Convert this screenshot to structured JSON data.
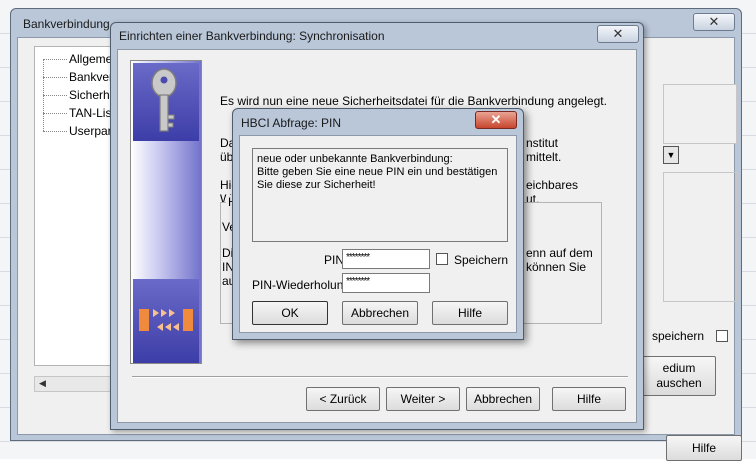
{
  "bank_window": {
    "title": "Bankverbindung",
    "close_glyph": "✕",
    "tree_items": [
      "Allgemein",
      "Bankverbin",
      "Sicherheits",
      "TAN-Listen",
      "Userparam"
    ],
    "save_label": "speichern",
    "medium_button_label": "edium\nauschen",
    "help_button": "Hilfe"
  },
  "setup_window": {
    "title": "Einrichten einer Bankverbindung: Synchronisation",
    "close_glyph": "✕",
    "intro_text": "Es wird nun eine neue Sicherheitsdatei für die Bankverbindung angelegt.",
    "para1_left": [
      "Da",
      "übe"
    ],
    "para1_right": [
      "nstitut",
      "mittelt."
    ],
    "para2_left": [
      "Hie",
      "We"
    ],
    "para2_right": [
      "eichbares",
      "ut."
    ],
    "group_left": [
      "H",
      "Ve",
      "Di",
      "IN",
      "au"
    ],
    "group_right": [
      "enn auf dem",
      "können Sie"
    ],
    "buttons": {
      "back": "< Zurück",
      "next": "Weiter >",
      "cancel": "Abbrechen",
      "help": "Hilfe"
    }
  },
  "pin_dialog": {
    "title": "HBCI Abfrage: PIN",
    "close_glyph": "✕",
    "message": "neue oder unbekannte Bankverbindung:\n Bitte geben Sie eine neue PIN ein und bestätigen\nSie diese zur Sicherheit!",
    "pin_label": "PIN",
    "pin_value": "********",
    "save_label": "Speichern",
    "pin_repeat_label": "PIN-Wiederholung",
    "pin_repeat_value": "********",
    "buttons": {
      "ok": "OK",
      "cancel": "Abbrechen",
      "help": "Hilfe"
    }
  }
}
